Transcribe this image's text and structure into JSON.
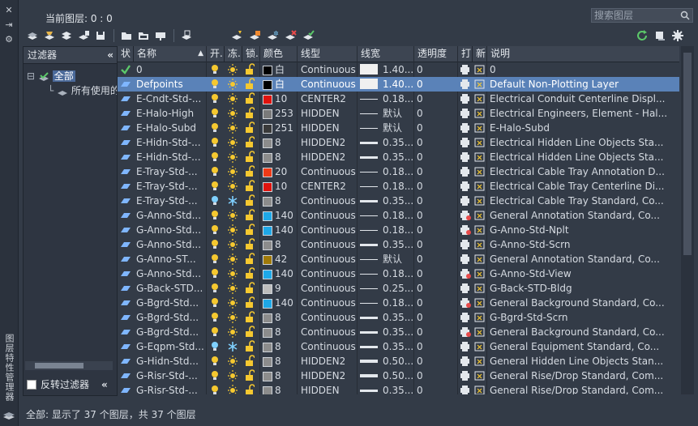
{
  "window": {
    "vertical_title": "图层特性管理器",
    "current_layer_label": "当前图层: 0 : 0",
    "search_placeholder": "搜索图层"
  },
  "filters": {
    "header": "过滤器",
    "tree": [
      {
        "label": "全部",
        "selected": true
      },
      {
        "label": "所有使用的图层",
        "selected": false
      }
    ],
    "invert_label": "反转过滤器"
  },
  "columns": [
    "状",
    "名称",
    "开.",
    "冻.",
    "锁.",
    "颜色",
    "线型",
    "线宽",
    "透明度",
    "打",
    "新",
    "说明"
  ],
  "layers": [
    {
      "status": "current",
      "name": "0",
      "on": true,
      "frozen": false,
      "color_hex": "#000000",
      "color": "白",
      "linetype": "Continuous",
      "lineweight": "1.40...",
      "lw_style": "box",
      "transparency": "0",
      "plot": "print",
      "desc": "0"
    },
    {
      "status": "layer",
      "name": "Defpoints",
      "on": true,
      "frozen": false,
      "color_hex": "#000000",
      "color": "白",
      "linetype": "Continuous",
      "lineweight": "1.40...",
      "lw_style": "box",
      "transparency": "0",
      "plot": "print",
      "desc": "Default Non-Plotting Layer",
      "selected": true
    },
    {
      "status": "layer",
      "name": "E-Cndt-Std-...",
      "on": true,
      "frozen": false,
      "color_hex": "#e0130e",
      "color": "10",
      "linetype": "CENTER2",
      "lineweight": "0.18...",
      "lw_style": "thin",
      "transparency": "0",
      "plot": "print",
      "desc": "Electrical Conduit Centerline Displ..."
    },
    {
      "status": "layer",
      "name": "E-Halo-High",
      "on": true,
      "frozen": false,
      "color_hex": "#7a7a7a",
      "color": "253",
      "linetype": "HIDDEN",
      "lineweight": "默认",
      "lw_style": "thin",
      "transparency": "0",
      "plot": "print",
      "desc": "Electrical Engineers, Element - Hal..."
    },
    {
      "status": "layer",
      "name": "E-Halo-Subd",
      "on": true,
      "frozen": false,
      "color_hex": "#3a3a3a",
      "color": "251",
      "linetype": "HIDDEN",
      "lineweight": "默认",
      "lw_style": "thin",
      "transparency": "0",
      "plot": "print",
      "desc": "E-Halo-Subd"
    },
    {
      "status": "layer",
      "name": "E-Hidn-Std-...",
      "on": true,
      "frozen": false,
      "color_hex": "#8c8c8c",
      "color": "8",
      "linetype": "HIDDEN2",
      "lineweight": "0.35...",
      "lw_style": "med",
      "transparency": "0",
      "plot": "print",
      "desc": "Electrical Hidden Line Objects Sta..."
    },
    {
      "status": "layer",
      "name": "E-Hidn-Std-...",
      "on": true,
      "frozen": false,
      "color_hex": "#8c8c8c",
      "color": "8",
      "linetype": "HIDDEN2",
      "lineweight": "0.35...",
      "lw_style": "med",
      "transparency": "0",
      "plot": "print",
      "desc": "Electrical Hidden Line Objects Sta..."
    },
    {
      "status": "layer",
      "name": "E-Tray-Std-...",
      "on": true,
      "frozen": false,
      "color_hex": "#ef3a17",
      "color": "20",
      "linetype": "Continuous",
      "lineweight": "0.18...",
      "lw_style": "thin",
      "transparency": "0",
      "plot": "print",
      "desc": "Electrical Cable Tray Annotation D..."
    },
    {
      "status": "layer",
      "name": "E-Tray-Std-...",
      "on": true,
      "frozen": false,
      "color_hex": "#e0130e",
      "color": "10",
      "linetype": "CENTER2",
      "lineweight": "0.18...",
      "lw_style": "thin",
      "transparency": "0",
      "plot": "print",
      "desc": "Electrical Cable Tray Centerline Di..."
    },
    {
      "status": "layer",
      "name": "E-Tray-Std-...",
      "on": false,
      "frozen": true,
      "color_hex": "#8c8c8c",
      "color": "8",
      "linetype": "Continuous",
      "lineweight": "0.35...",
      "lw_style": "med",
      "transparency": "0",
      "plot": "print",
      "desc": "Electrical Cable Tray Standard, Co..."
    },
    {
      "status": "layer",
      "name": "G-Anno-Std...",
      "on": true,
      "frozen": false,
      "color_hex": "#1ea8e8",
      "color": "140",
      "linetype": "Continuous",
      "lineweight": "0.18...",
      "lw_style": "thin",
      "transparency": "0",
      "plot": "noprint",
      "desc": "General Annotation Standard, Co..."
    },
    {
      "status": "layer",
      "name": "G-Anno-Std...",
      "on": true,
      "frozen": false,
      "color_hex": "#1ea8e8",
      "color": "140",
      "linetype": "Continuous",
      "lineweight": "0.18...",
      "lw_style": "thin",
      "transparency": "0",
      "plot": "noprint",
      "desc": "G-Anno-Std-Nplt"
    },
    {
      "status": "layer",
      "name": "G-Anno-Std...",
      "on": true,
      "frozen": false,
      "color_hex": "#8c8c8c",
      "color": "8",
      "linetype": "Continuous",
      "lineweight": "0.35...",
      "lw_style": "med",
      "transparency": "0",
      "plot": "print",
      "desc": "G-Anno-Std-Scrn"
    },
    {
      "status": "layer",
      "name": "G-Anno-ST...",
      "on": true,
      "frozen": false,
      "color_hex": "#a07a0a",
      "color": "42",
      "linetype": "Continuous",
      "lineweight": "默认",
      "lw_style": "thin",
      "transparency": "0",
      "plot": "print",
      "desc": "General Annotation Standard, Co..."
    },
    {
      "status": "layer",
      "name": "G-Anno-Std...",
      "on": true,
      "frozen": false,
      "color_hex": "#1ea8e8",
      "color": "140",
      "linetype": "Continuous",
      "lineweight": "0.18...",
      "lw_style": "thin",
      "transparency": "0",
      "plot": "noprint",
      "desc": "G-Anno-Std-View"
    },
    {
      "status": "layer",
      "name": "G-Back-STD...",
      "on": true,
      "frozen": false,
      "color_hex": "#bdbdbd",
      "color": "9",
      "linetype": "Continuous",
      "lineweight": "0.25...",
      "lw_style": "thin",
      "transparency": "0",
      "plot": "print",
      "desc": "G-Back-STD-Bldg"
    },
    {
      "status": "layer",
      "name": "G-Bgrd-Std...",
      "on": true,
      "frozen": false,
      "color_hex": "#1ea8e8",
      "color": "140",
      "linetype": "Continuous",
      "lineweight": "0.18...",
      "lw_style": "thin",
      "transparency": "0",
      "plot": "noprint",
      "desc": "General Background Standard, Co..."
    },
    {
      "status": "layer",
      "name": "G-Bgrd-Std...",
      "on": true,
      "frozen": false,
      "color_hex": "#8c8c8c",
      "color": "8",
      "linetype": "Continuous",
      "lineweight": "0.35...",
      "lw_style": "med",
      "transparency": "0",
      "plot": "print",
      "desc": "G-Bgrd-Std-Scrn"
    },
    {
      "status": "layer",
      "name": "G-Bgrd-Std...",
      "on": true,
      "frozen": false,
      "color_hex": "#8c8c8c",
      "color": "8",
      "linetype": "Continuous",
      "lineweight": "0.35...",
      "lw_style": "med",
      "transparency": "0",
      "plot": "noprint",
      "desc": "General Background Standard, Co..."
    },
    {
      "status": "layer",
      "name": "G-Eqpm-Std...",
      "on": false,
      "frozen": true,
      "color_hex": "#8c8c8c",
      "color": "8",
      "linetype": "Continuous",
      "lineweight": "0.35...",
      "lw_style": "med",
      "transparency": "0",
      "plot": "print",
      "desc": "General Equipment Standard, Co..."
    },
    {
      "status": "layer",
      "name": "G-Hidn-Std...",
      "on": true,
      "frozen": false,
      "color_hex": "#8c8c8c",
      "color": "8",
      "linetype": "HIDDEN2",
      "lineweight": "0.50...",
      "lw_style": "thick",
      "transparency": "0",
      "plot": "print",
      "desc": "General Hidden Line Objects Stan..."
    },
    {
      "status": "layer",
      "name": "G-Risr-Std-...",
      "on": true,
      "frozen": false,
      "color_hex": "#8c8c8c",
      "color": "8",
      "linetype": "HIDDEN2",
      "lineweight": "0.50...",
      "lw_style": "thick",
      "transparency": "0",
      "plot": "print",
      "desc": "General Rise/Drop Standard, Com..."
    },
    {
      "status": "layer",
      "name": "G-Risr-Std-...",
      "on": true,
      "frozen": false,
      "color_hex": "#8c8c8c",
      "color": "8",
      "linetype": "HIDDEN",
      "lineweight": "0.35...",
      "lw_style": "med",
      "transparency": "0",
      "plot": "print",
      "desc": "General Rise/Drop Standard, Com..."
    }
  ],
  "status_bar": "全部: 显示了 37 个图层，共 37 个图层"
}
